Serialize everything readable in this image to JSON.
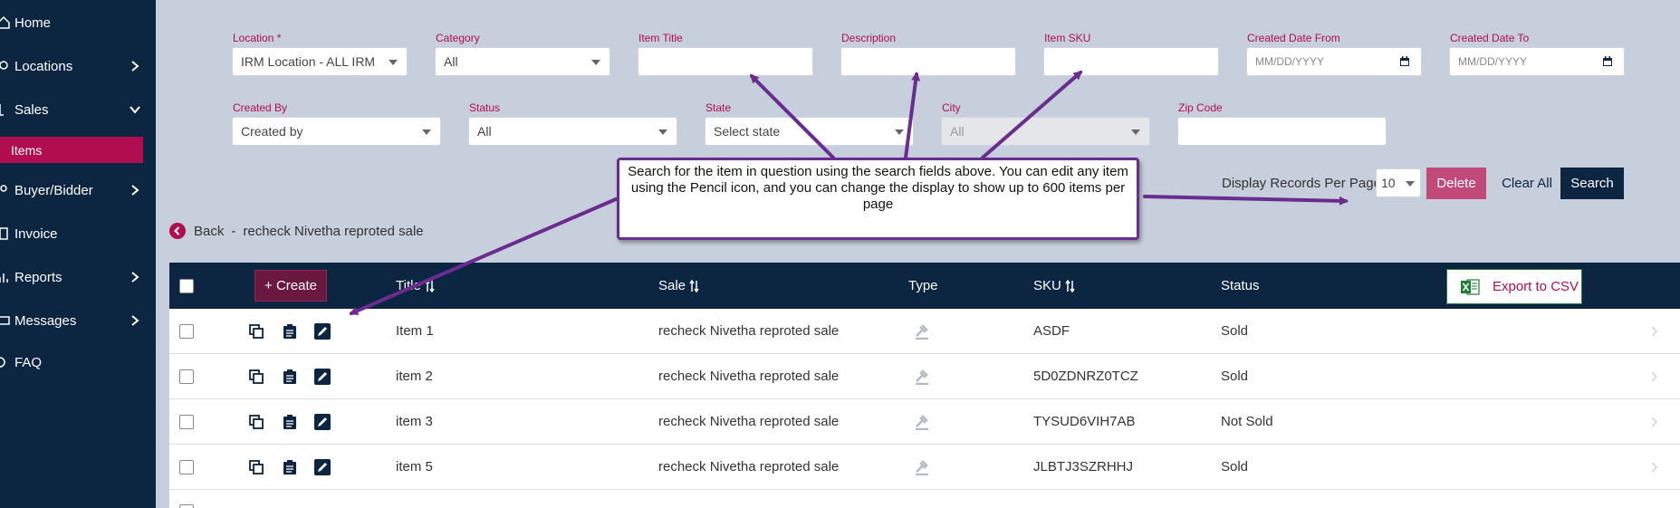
{
  "sidebar": {
    "items": [
      {
        "label": "Home",
        "has_chevron": false
      },
      {
        "label": "Locations",
        "has_chevron": true
      },
      {
        "label": "Sales",
        "has_chevron": true
      },
      {
        "label": "Items",
        "active": true
      },
      {
        "label": "Buyer/Bidder",
        "has_chevron": true
      },
      {
        "label": "Invoice",
        "has_chevron": false
      },
      {
        "label": "Reports",
        "has_chevron": true
      },
      {
        "label": "Messages",
        "has_chevron": true
      },
      {
        "label": "FAQ",
        "has_chevron": false
      }
    ]
  },
  "filters": {
    "location": {
      "label": "Location *",
      "value": "IRM Location - ALL IRM"
    },
    "category": {
      "label": "Category",
      "value": "All"
    },
    "item_title": {
      "label": "Item Title",
      "value": ""
    },
    "description": {
      "label": "Description",
      "value": ""
    },
    "item_sku": {
      "label": "Item SKU",
      "value": ""
    },
    "created_from": {
      "label": "Created Date From",
      "placeholder": "MM/DD/YYYY"
    },
    "created_to": {
      "label": "Created Date To",
      "placeholder": "MM/DD/YYYY"
    },
    "created_by": {
      "label": "Created By",
      "value": "Created by"
    },
    "status": {
      "label": "Status",
      "value": "All"
    },
    "state": {
      "label": "State",
      "value": "Select state"
    },
    "city": {
      "label": "City",
      "value": "All"
    },
    "zip": {
      "label": "Zip Code",
      "value": ""
    }
  },
  "toolbar": {
    "records_label": "Display Records Per Page",
    "records_value": "10",
    "delete_label": "Delete",
    "clear_label": "Clear All",
    "search_label": "Search"
  },
  "back": {
    "label": "Back",
    "separator": "-",
    "sale_name": "recheck Nivetha reproted sale"
  },
  "table": {
    "create_label": "+ Create",
    "export_label": "Export to CSV",
    "columns": [
      "Title",
      "Sale",
      "Type",
      "SKU",
      "Status"
    ],
    "rows": [
      {
        "title": "Item 1",
        "sale": "recheck Nivetha reproted sale",
        "sku": "ASDF",
        "status": "Sold"
      },
      {
        "title": "item 2",
        "sale": "recheck Nivetha reproted sale",
        "sku": "5D0ZDNRZ0TCZ",
        "status": "Sold"
      },
      {
        "title": "item 3",
        "sale": "recheck Nivetha reproted sale",
        "sku": "TYSUD6VIH7AB",
        "status": "Not Sold"
      },
      {
        "title": "item 5",
        "sale": "recheck Nivetha reproted sale",
        "sku": "JLBTJ3SZRHHJ",
        "status": "Sold"
      }
    ]
  },
  "callout": {
    "text": "Search for the item in question using the search fields above. You can edit any item using the Pencil icon, and you can change the display to show up to 600 items per page"
  },
  "colors": {
    "sidebar_bg": "#0c2541",
    "accent": "#b10e4f",
    "callout_border": "#6a2c8f",
    "filter_bg": "#c6cfdb"
  }
}
